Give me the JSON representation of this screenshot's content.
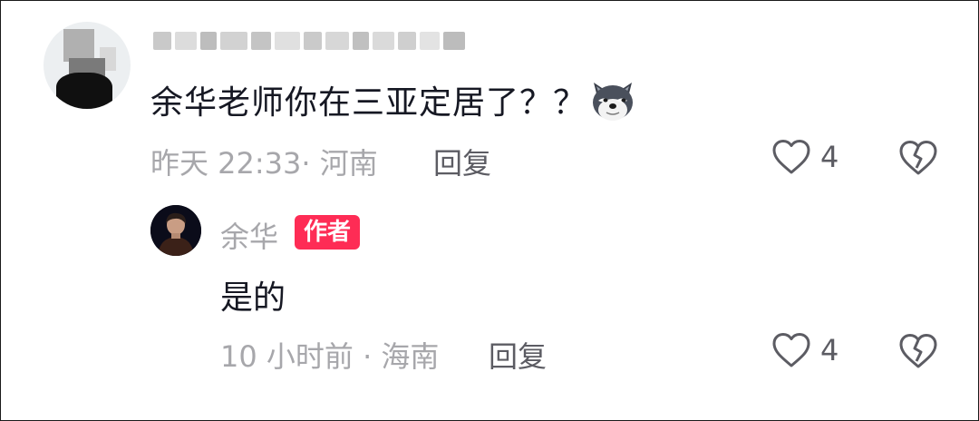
{
  "comment": {
    "text": "余华老师你在三亚定居了？？",
    "emoji_icon": "doge-wolf-emoji",
    "time_location": "昨天 22:33· 河南",
    "reply_label": "回复",
    "like_count": "4",
    "like_icon": "heart-outline-icon",
    "dislike_icon": "broken-heart-icon"
  },
  "reply": {
    "author_name": "余华",
    "author_badge": "作者",
    "text": "是的",
    "time_location": "10 小时前 · 海南",
    "reply_label": "回复",
    "like_count": "4",
    "like_icon": "heart-outline-icon",
    "dislike_icon": "broken-heart-icon"
  },
  "colors": {
    "text_primary": "#161823",
    "text_secondary": "#a7a7ab",
    "action_text": "#5c5c63",
    "badge_bg": "#fe2c55",
    "badge_text": "#ffffff"
  }
}
